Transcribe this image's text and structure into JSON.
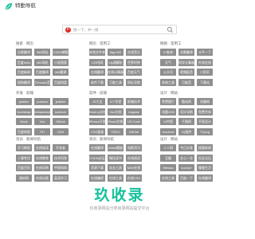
{
  "brand": {
    "name": "特勤导航",
    "accent": "#18c29c"
  },
  "search": {
    "engine_label": "P",
    "placeholder": "搜一下，并一搜"
  },
  "sections": [
    {
      "title": "搜索 · 网页",
      "items": [
        "谷歌翻译",
        "360网站",
        "CSDN博客",
        "百度hello",
        "360导航",
        "小说搜索",
        "百度新闻",
        "百度翻译",
        "360翻译",
        "搜狗翻译",
        "TOmusic音乐",
        "百度网盘"
      ]
    },
    {
      "title": "网页 · 常用工",
      "items": [
        "本地文件夹",
        "flag 900",
        "在线音乐",
        "123内网",
        "Vip源解析",
        "世界时钟",
        "在线翻译",
        "在线计算器",
        "百度天气",
        "软件下载",
        "万能工具",
        "网址导航"
      ]
    },
    {
      "title": "网络 · 常用工",
      "items": [
        "IP查询",
        "谷歌翻译",
        "斗牛一下",
        "天气",
        "科学计算器",
        "外卖在线",
        "公众号",
        "视频配音",
        "IT资讯",
        "系统工具",
        "万能音",
        "下载站"
      ]
    },
    {
      "title": "开发 · 前端",
      "items": [
        "jsdelivr",
        "postcss",
        "jsdelivr",
        "bootstrap",
        "fontawesome",
        "iconfont",
        "Mock",
        "Vue",
        "Github",
        "百度地图",
        "PH",
        "CDN"
      ]
    },
    {
      "title": "软件 · 前端",
      "items": [
        "JS大全",
        "ICT学堂",
        "前端技术",
        "Node.js文档",
        "Vue文档",
        "Angular",
        "iPhone开发",
        "React文档",
        "VS Code",
        "CSS速查",
        "TEDO",
        "GitHub"
      ]
    },
    {
      "title": "设计 · 网站",
      "items": [
        "免费图片",
        "酷站网",
        "花瓣网",
        "站酷JOB",
        "设计导航",
        "免费字体",
        "UI中国",
        "千图网",
        "平面设计",
        "Iconfont",
        "JQ插件",
        "TOpng"
      ]
    },
    {
      "title": "资讯 · 新闻导航",
      "items": [
        "学习教程",
        "在线阅读",
        "开发者",
        "人事考试",
        "在线教育",
        "技术问答",
        "百度百科",
        "在线词典",
        "中国知网",
        "政府网",
        "在线出版",
        "英语学习"
      ]
    },
    {
      "title": "资讯 · 新闻导航",
      "items": [
        "在线翻译",
        "bilibili播放",
        "电影资讯",
        "CSDN论坛",
        "微信读书",
        "在线阅读",
        "资源下载",
        "站长工具",
        "MD5在线",
        "在线编程",
        "在线工具",
        "在线CSS"
      ]
    },
    {
      "title": "设计 · 网站",
      "items": [
        "人人网",
        "今日头条",
        "搜狐新闻",
        "豆瓣",
        "文心一言",
        "社区论坛",
        "Himaso",
        "sourcer",
        "慢慢生活",
        "在线工具",
        "百度一下",
        "在线翻译"
      ]
    }
  ],
  "watermark": {
    "title": "玖收录",
    "subtitle": "玖收录网站分类目录网站提交平台"
  }
}
